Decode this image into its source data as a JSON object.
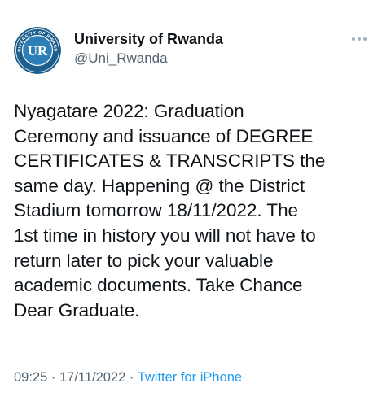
{
  "author": {
    "display_name": "University of Rwanda",
    "handle": "@Uni_Rwanda",
    "avatar_monogram": "UR",
    "avatar_ring_text": "UNIVERSITY OF RWANDA",
    "avatar_colors": {
      "ring": "#1c5f8d",
      "inner": "#2e7fb8",
      "text": "#ffffff"
    }
  },
  "more_button_icon": "more-horizontal-icon",
  "tweet": {
    "lines": [
      "Nyagatare 2022: Graduation",
      "Ceremony and issuance of DEGREE",
      "CERTIFICATES & TRANSCRIPTS the",
      "same day. Happening @ the District",
      "Stadium tomorrow 18/11/2022. The",
      "1st time in history you will not have to",
      "return later to pick your valuable",
      "academic documents. Take Chance",
      "Dear Graduate."
    ]
  },
  "meta": {
    "time": "09:25",
    "separator": " · ",
    "date": "17/11/2022",
    "source": "Twitter for iPhone"
  },
  "colors": {
    "primary_text": "#0f1419",
    "secondary_text": "#536471",
    "link": "#1d9bf0"
  }
}
